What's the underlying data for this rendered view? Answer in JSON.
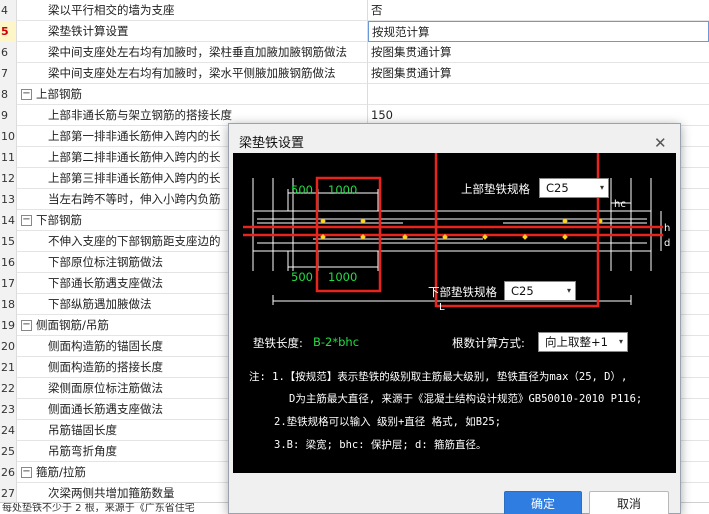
{
  "grid_rows": [
    {
      "num": "4",
      "name": "梁以平行相交的墙为支座",
      "value": "否",
      "kind": "child"
    },
    {
      "num": "5",
      "name": "梁垫铁计算设置",
      "value": "按规范计算",
      "kind": "child",
      "selected": true
    },
    {
      "num": "6",
      "name": "梁中间支座处左右均有加腋时，梁柱垂直加腋加腋钢筋做法",
      "value": "按图集贯通计算",
      "kind": "child"
    },
    {
      "num": "7",
      "name": "梁中间支座处左右均有加腋时，梁水平侧腋加腋钢筋做法",
      "value": "按图集贯通计算",
      "kind": "child"
    },
    {
      "num": "8",
      "name": "上部钢筋",
      "value": "",
      "kind": "group"
    },
    {
      "num": "9",
      "name": "上部非通长筋与架立钢筋的搭接长度",
      "value": "150",
      "kind": "child"
    },
    {
      "num": "10",
      "name": "上部第一排非通长筋伸入跨内的长",
      "value": "",
      "kind": "child"
    },
    {
      "num": "11",
      "name": "上部第二排非通长筋伸入跨内的长",
      "value": "",
      "kind": "child"
    },
    {
      "num": "12",
      "name": "上部第三排非通长筋伸入跨内的长",
      "value": "",
      "kind": "child"
    },
    {
      "num": "13",
      "name": "当左右跨不等时，伸入小跨内负筋",
      "value": "",
      "kind": "child"
    },
    {
      "num": "14",
      "name": "下部钢筋",
      "value": "",
      "kind": "group"
    },
    {
      "num": "15",
      "name": "不伸入支座的下部钢筋距支座边的",
      "value": "",
      "kind": "child"
    },
    {
      "num": "16",
      "name": "下部原位标注钢筋做法",
      "value": "",
      "kind": "child"
    },
    {
      "num": "17",
      "name": "下部通长筋遇支座做法",
      "value": "",
      "kind": "child"
    },
    {
      "num": "18",
      "name": "下部纵筋遇加腋做法",
      "value": "",
      "kind": "child"
    },
    {
      "num": "19",
      "name": "侧面钢筋/吊筋",
      "value": "",
      "kind": "group"
    },
    {
      "num": "20",
      "name": "侧面构造筋的锚固长度",
      "value": "",
      "kind": "child"
    },
    {
      "num": "21",
      "name": "侧面构造筋的搭接长度",
      "value": "",
      "kind": "child"
    },
    {
      "num": "22",
      "name": "梁侧面原位标注筋做法",
      "value": "",
      "kind": "child"
    },
    {
      "num": "23",
      "name": "侧面通长筋遇支座做法",
      "value": "",
      "kind": "child"
    },
    {
      "num": "24",
      "name": "吊筋锚固长度",
      "value": "",
      "kind": "child"
    },
    {
      "num": "25",
      "name": "吊筋弯折角度",
      "value": "",
      "kind": "child"
    },
    {
      "num": "26",
      "name": "箍筋/拉筋",
      "value": "",
      "kind": "group"
    },
    {
      "num": "27",
      "name": "次梁两侧共增加箍筋数量",
      "value": "",
      "kind": "child"
    }
  ],
  "bottom_text": "每处垫铁不少于 2 根，来源于《广东省住宅",
  "dialog": {
    "title": "梁垫铁设置",
    "close_glyph": "✕",
    "diagram": {
      "top_spec_label": "上部垫铁规格",
      "top_spec_value": "C25",
      "bottom_spec_label": "下部垫铁规格",
      "bottom_spec_value": "C25",
      "top_dim_500": "500",
      "top_dim_1000": "1000",
      "bottom_dim_500": "500",
      "bottom_dim_1000": "1000",
      "hc_label": "hc",
      "h_label": "h",
      "d_label": "d",
      "l_label": "L"
    },
    "length_label": "垫铁长度:",
    "length_value": "B-2*bhc",
    "root_calc_label": "根数计算方式:",
    "root_calc_value": "向上取整+1",
    "notes": [
      "注: 1.【按规范】表示垫铁的级别取主筋最大级别, 垫铁直径为max（25, D）,",
      "D为主筋最大直径, 来源于《混凝土结构设计规范》GB50010-2010 P116;",
      "2.垫铁规格可以输入 级别+直径 格式, 如B25;",
      "3.B: 梁宽; bhc: 保护层; d: 箍筋直径。"
    ],
    "ok_label": "确定",
    "cancel_label": "取消"
  },
  "colors": {
    "highlight_red": "#e8251c",
    "diagram_green": "#22dd44",
    "ok_blue": "#2f7de1",
    "rebar_red": "#e8251c",
    "marker_yellow": "#ffd21f"
  }
}
